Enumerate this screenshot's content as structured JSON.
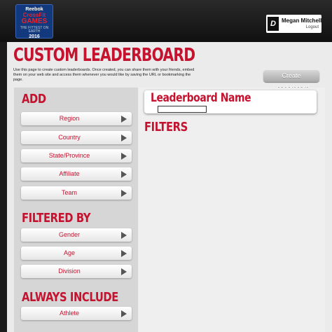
{
  "header": {
    "logo": {
      "brand": "Reebok",
      "line1": "CrossFit",
      "line2": "GAMES",
      "tagline": "THE FITTEST ON EARTH",
      "year": "2016"
    },
    "user": {
      "name": "Megan Mitchell",
      "logout_label": "Logout"
    }
  },
  "main": {
    "title": "CUSTOM LEADERBOARD",
    "intro": "Use this page to create custom leaderboards. Once created, you can share them with your friends, embed them on your web site and access them whenever you would like by saving the URL or bookmarking the page.",
    "create_button": "Create Leaderboard"
  },
  "add_panel": {
    "add_heading": "ADD",
    "add_items": [
      "Region",
      "Country",
      "State/Province",
      "Affiliate",
      "Team"
    ],
    "filtered_heading": "FILTERED BY",
    "filtered_items": [
      "Gender",
      "Age",
      "Division"
    ],
    "always_heading": "ALWAYS INCLUDE",
    "always_items": [
      "Athlete"
    ]
  },
  "right_panel": {
    "leaderboard_name_label": "Leaderboard Name",
    "leaderboard_name_value": "",
    "filters_heading": "FILTERS"
  },
  "colors": {
    "accent": "#c4122f",
    "panel": "#d6d6d6",
    "background": "#ebebeb"
  }
}
